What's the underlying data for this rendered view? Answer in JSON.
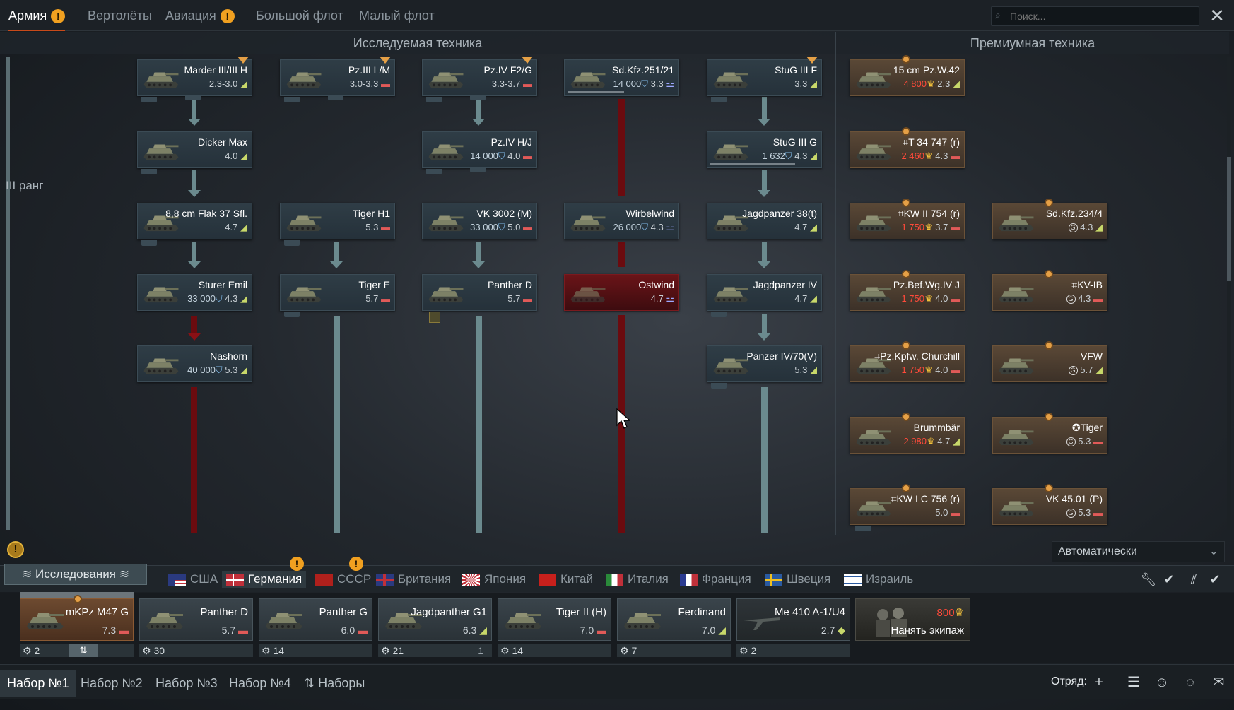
{
  "top_tabs": [
    {
      "label": "Армия",
      "warn": true,
      "active": true
    },
    {
      "label": "Вертолёты",
      "warn": false
    },
    {
      "label": "Авиация",
      "warn": true
    },
    {
      "label": "Большой флот",
      "warn": false
    },
    {
      "label": "Малый флот",
      "warn": false
    }
  ],
  "search": {
    "placeholder": "Поиск..."
  },
  "sections": {
    "researched": "Исследуемая техника",
    "premium": "Премиумная техника"
  },
  "rank_label": "III ранг",
  "warn_glyph": "!",
  "tree_vehicles": {
    "marder": {
      "name": "Marder III/III H",
      "stats": "2.3-3.0",
      "icon": "ico-g",
      "glyph": "◢"
    },
    "pz3lm": {
      "name": "Pz.III L/M",
      "stats": "3.0-3.3",
      "icon": "ico-r",
      "glyph": "▬"
    },
    "pz4fg": {
      "name": "Pz.IV F2/G",
      "stats": "3.3-3.7",
      "icon": "ico-r",
      "glyph": "▬"
    },
    "sdkfz251": {
      "name": "Sd.Kfz.251/21",
      "cost": "14 000",
      "stats": "3.3",
      "icon": "ico-b",
      "glyph": "⚍"
    },
    "stug3f": {
      "name": "StuG III F",
      "stats": "3.3",
      "icon": "ico-g",
      "glyph": "◢"
    },
    "dicker": {
      "name": "Dicker Max",
      "stats": "4.0",
      "icon": "ico-g",
      "glyph": "◢"
    },
    "pz4hj": {
      "name": "Pz.IV H/J",
      "cost": "14 000",
      "stats": "4.0",
      "icon": "ico-r",
      "glyph": "▬"
    },
    "stug3g": {
      "name": "StuG III G",
      "cost": "1 632",
      "stats": "4.3",
      "icon": "ico-g",
      "glyph": "◢"
    },
    "flak37": {
      "name": "8,8 cm Flak 37 Sfl.",
      "stats": "4.7",
      "icon": "ico-g",
      "glyph": "◢"
    },
    "tigerh1": {
      "name": "Tiger H1",
      "stats": "5.3",
      "icon": "ico-r",
      "glyph": "▬"
    },
    "vk3002": {
      "name": "VK 3002 (M)",
      "cost": "33 000",
      "stats": "5.0",
      "icon": "ico-r",
      "glyph": "▬"
    },
    "wirbelwind": {
      "name": "Wirbelwind",
      "cost": "26 000",
      "stats": "4.3",
      "icon": "ico-b",
      "glyph": "⚍"
    },
    "jp38t": {
      "name": "Jagdpanzer 38(t)",
      "stats": "4.7",
      "icon": "ico-g",
      "glyph": "◢"
    },
    "sturer": {
      "name": "Sturer Emil",
      "cost": "33 000",
      "stats": "4.3",
      "icon": "ico-g",
      "glyph": "◢"
    },
    "tigere": {
      "name": "Tiger E",
      "stats": "5.7",
      "icon": "ico-r",
      "glyph": "▬"
    },
    "pantherd": {
      "name": "Panther D",
      "stats": "5.7",
      "icon": "ico-r",
      "glyph": "▬"
    },
    "ostwind": {
      "name": "Ostwind",
      "stats": "4.7",
      "icon": "ico-b",
      "glyph": "⚍"
    },
    "jp4": {
      "name": "Jagdpanzer IV",
      "stats": "4.7",
      "icon": "ico-g",
      "glyph": "◢"
    },
    "nashorn": {
      "name": "Nashorn",
      "cost": "40 000",
      "stats": "5.3",
      "icon": "ico-g",
      "glyph": "◢"
    },
    "pz4_70": {
      "name": "Panzer IV/70(V)",
      "stats": "5.3",
      "icon": "ico-g",
      "glyph": "◢"
    }
  },
  "premium_vehicles": {
    "pzw42": {
      "name": "15 cm Pz.W.42",
      "cost": "4 800",
      "stats": "2.3",
      "icon": "ico-g",
      "glyph": "◢"
    },
    "t34": {
      "name": "⌗T 34 747 (r)",
      "cost": "2 460",
      "stats": "4.3",
      "icon": "ico-r",
      "glyph": "▬"
    },
    "kw2": {
      "name": "⌗KW II 754 (r)",
      "cost": "1 750",
      "stats": "3.7",
      "icon": "ico-r",
      "glyph": "▬"
    },
    "sdkfz234": {
      "name": "Sd.Kfz.234/4",
      "stats": "4.3",
      "icon": "ico-g",
      "glyph": "◢"
    },
    "pzbef": {
      "name": "Pz.Bef.Wg.IV J",
      "cost": "1 750",
      "stats": "4.0",
      "icon": "ico-r",
      "glyph": "▬"
    },
    "kv1b": {
      "name": "⌗KV-IB",
      "stats": "4.3",
      "icon": "ico-r",
      "glyph": "▬"
    },
    "churchill": {
      "name": "⌗Pz.Kpfw. Churchill",
      "cost": "1 750",
      "stats": "4.0",
      "icon": "ico-r",
      "glyph": "▬"
    },
    "vfw": {
      "name": "VFW",
      "stats": "5.7",
      "icon": "ico-g",
      "glyph": "◢"
    },
    "brummbar": {
      "name": "Brummbär",
      "cost": "2 980",
      "stats": "4.7",
      "icon": "ico-g",
      "glyph": "◢"
    },
    "tiger": {
      "name": "✪Tiger",
      "stats": "5.3",
      "icon": "ico-r",
      "glyph": "▬"
    },
    "kw1c": {
      "name": "⌗KW I C 756 (r)",
      "stats": "5.0",
      "icon": "ico-r",
      "glyph": "▬"
    },
    "vk4501": {
      "name": "VK 45.01 (P)",
      "stats": "5.3",
      "icon": "ico-r",
      "glyph": "▬"
    }
  },
  "currency": {
    "rp": "⛉",
    "gold": "♛",
    "coin": "G"
  },
  "bottom": {
    "research_label": "Исследования",
    "auto_select": "Автоматически",
    "squad_label": "Отряд:"
  },
  "nations": [
    {
      "label": "США"
    },
    {
      "label": "Германия",
      "active": true
    },
    {
      "label": "СССР"
    },
    {
      "label": "Британия"
    },
    {
      "label": "Япония"
    },
    {
      "label": "Китай"
    },
    {
      "label": "Италия"
    },
    {
      "label": "Франция"
    },
    {
      "label": "Швеция"
    },
    {
      "label": "Израиль"
    }
  ],
  "crew_slots": [
    {
      "name": "mKPz M47 G",
      "stats": "7.3",
      "icon": "ico-r",
      "glyph": "▬",
      "crew": "2"
    },
    {
      "name": "Panther D",
      "stats": "5.7",
      "icon": "ico-r",
      "glyph": "▬",
      "crew": "30"
    },
    {
      "name": "Panther G",
      "stats": "6.0",
      "icon": "ico-r",
      "glyph": "▬",
      "crew": "14"
    },
    {
      "name": "Jagdpanther G1",
      "stats": "6.3",
      "icon": "ico-g",
      "glyph": "◢",
      "crew": "21",
      "extra": "1"
    },
    {
      "name": "Tiger II (H)",
      "stats": "7.0",
      "icon": "ico-r",
      "glyph": "▬",
      "crew": "14"
    },
    {
      "name": "Ferdinand",
      "stats": "7.0",
      "icon": "ico-g",
      "glyph": "◢",
      "crew": "7"
    },
    {
      "name": "Me 410 A-1/U4",
      "stats": "2.7",
      "icon": "ico-g",
      "glyph": "◆",
      "crew": "2"
    }
  ],
  "hire": {
    "price": "800",
    "label": "Нанять экипаж"
  },
  "presets": [
    {
      "label": "Набор №1",
      "active": true
    },
    {
      "label": "Набор №2"
    },
    {
      "label": "Набор №3"
    },
    {
      "label": "Набор №4"
    },
    {
      "label": "Наборы"
    }
  ]
}
